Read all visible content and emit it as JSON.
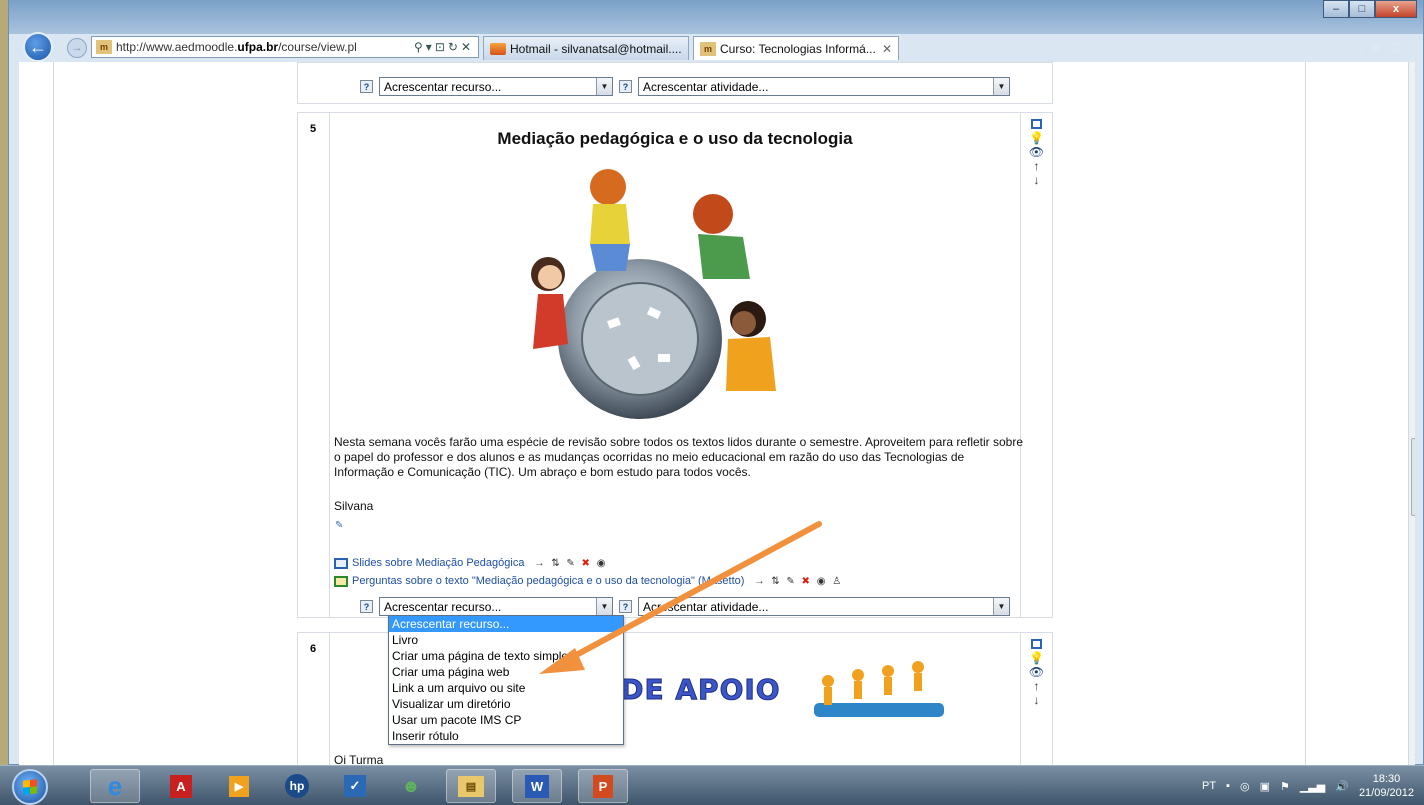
{
  "browser": {
    "address": {
      "url_prefix": "http://www.aedmoodle.",
      "url_domain": "ufpa.br",
      "url_suffix": "/course/view.pl"
    },
    "tabs": [
      {
        "label": "Hotmail - silvanatsal@hotmail...."
      },
      {
        "label": "Curso: Tecnologias Informá...",
        "close": "✕"
      }
    ]
  },
  "top_section": {
    "add_resource": "Acrescentar recurso...",
    "add_activity": "Acrescentar atividade..."
  },
  "section5": {
    "number": "5",
    "title": "Mediação pedagógica e o uso da tecnologia",
    "paragraph": "Nesta semana vocês farão uma espécie de revisão sobre todos os textos lidos durante o semestre. Aproveitem para refletir sobre o papel do professor e dos alunos e as mudanças ocorridas no meio educacional em razão do uso das Tecnologias de Informação e Comunicação (TIC). Um abraço e bom estudo para todos vocês.",
    "signature": "Silvana",
    "resources": [
      {
        "label": "Slides sobre Mediação Pedagógica"
      },
      {
        "label": "Perguntas sobre o texto \"Mediação pedagógica e o uso da tecnologia\" (Masetto)"
      }
    ],
    "add_resource": "Acrescentar recurso...",
    "add_activity": "Acrescentar atividade..."
  },
  "dropdown": {
    "options": [
      "Acrescentar recurso...",
      "Livro",
      "Criar uma página de texto simples",
      "Criar uma página web",
      "Link a um arquivo ou site",
      "Visualizar um diretório",
      "Usar um pacote IMS CP",
      "Inserir rótulo"
    ],
    "selected_index": 0
  },
  "section6": {
    "number": "6",
    "banner": "AL DE APOIO",
    "greeting": "Oi Turma"
  },
  "taskbar": {
    "language": "PT",
    "time": "18:30",
    "date": "21/09/2012"
  },
  "colors": {
    "link": "#1f4fa3",
    "selection": "#3399ff",
    "arrow": "#f2913d"
  }
}
